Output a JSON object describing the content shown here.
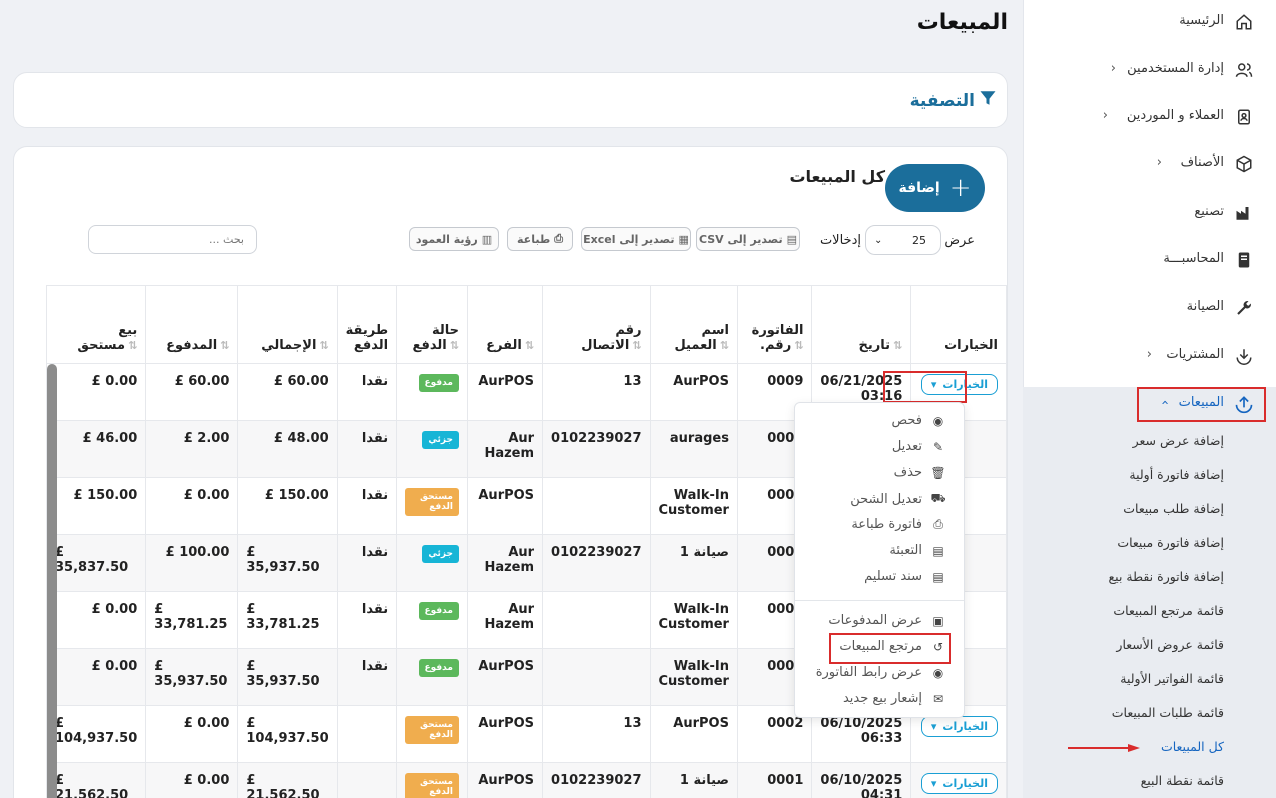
{
  "page": {
    "title": "المبيعات"
  },
  "sidebar": {
    "items": [
      {
        "label": "الرئيسية",
        "icon": "home-icon"
      },
      {
        "label": "إدارة المستخدمين",
        "icon": "users-icon"
      },
      {
        "label": "العملاء و الموردين",
        "icon": "contacts-icon"
      },
      {
        "label": "الأصناف",
        "icon": "box-icon"
      },
      {
        "label": "تصنيع",
        "icon": "factory-icon"
      },
      {
        "label": "المحاسبـــة",
        "icon": "book-icon"
      },
      {
        "label": "الصيانة",
        "icon": "wrench-icon"
      },
      {
        "label": "المشتريات",
        "icon": "download-icon"
      },
      {
        "label": "المبيعات",
        "icon": "upload-icon"
      }
    ],
    "sales_submenu": [
      "إضافة عرض سعر",
      "إضافة فاتورة أولية",
      "إضافة طلب مبيعات",
      "إضافة فاتورة مبيعات",
      "إضافة فاتورة نقطة بيع",
      "قائمة مرتجع المبيعات",
      "قائمة عروض الأسعار",
      "قائمة الفواتير الأولية",
      "قائمة طلبات المبيعات",
      "كل المبيعات",
      "قائمة نقطة البيع"
    ],
    "active_sub": "كل المبيعات"
  },
  "filter": {
    "title": "التصفية"
  },
  "list": {
    "title": "كل المبيعات",
    "add_label": "إضافة",
    "show_label": "عرض",
    "entries_value": "25",
    "entries_label": "إدخالات",
    "buttons": {
      "csv": "تصدير إلى CSV",
      "excel": "تصدير إلى Excel",
      "print": "طباعة",
      "columns": "رؤية العمود"
    },
    "search_placeholder": "بحث ..."
  },
  "table": {
    "headers": {
      "options": "الخيارات",
      "date": "تاريخ",
      "invoice_no_1": "رقم.",
      "invoice_no_2": "الفاتورة",
      "customer_1": "اسم",
      "customer_2": "العميل",
      "phone_1": "رقم",
      "phone_2": "الاتصال",
      "branch": "الفرع",
      "pay_status_1": "حالة",
      "pay_status_2": "الدفع",
      "pay_method_1": "طريقة",
      "pay_method_2": "الدفع",
      "total": "الإجمالي",
      "paid": "المدفوع",
      "due_1": "بيع",
      "due_2": "مستحق"
    },
    "options_label": "الخيارات",
    "rows": [
      {
        "date": "06/21/2025",
        "time": "03:16",
        "invoice": "0009",
        "customer": "AurPOS",
        "phone": "13",
        "branch": "AurPOS",
        "status": "مدفوع",
        "status_color": "#5cb85c",
        "method": "نقدا",
        "total": "£ 60.00",
        "paid": "£ 60.00",
        "due": "£ 0.00",
        "show_option": true
      },
      {
        "date": "",
        "time": "",
        "invoice": "0008",
        "customer": "aurages",
        "phone": "0102239027",
        "branch": "Aur Hazem",
        "status": "جزئي",
        "status_color": "#17b5d6",
        "method": "نقدا",
        "total": "£ 48.00",
        "paid": "£ 2.00",
        "due": "£ 46.00",
        "show_option": false
      },
      {
        "date": "",
        "time": "",
        "invoice": "0007",
        "customer": "Walk-In Customer",
        "phone": "",
        "branch": "AurPOS",
        "status": "مستحق الدفع",
        "status_color": "#f0ad4e",
        "method": "نقدا",
        "total": "£ 150.00",
        "paid": "£ 0.00",
        "due": "£ 150.00",
        "show_option": false
      },
      {
        "date": "",
        "time": "",
        "invoice": "0006",
        "customer": "صيانة 1",
        "phone": "0102239027",
        "branch": "Aur Hazem",
        "status": "جزئي",
        "status_color": "#17b5d6",
        "method": "نقدا",
        "total": "£ 35,937.50",
        "paid": "£ 100.00",
        "due": "£ 35,837.50",
        "show_option": false
      },
      {
        "date": "",
        "time": "",
        "invoice": "0005",
        "customer": "Walk-In Customer",
        "phone": "",
        "branch": "Aur Hazem",
        "status": "مدفوع",
        "status_color": "#5cb85c",
        "method": "نقدا",
        "total": "£ 33,781.25",
        "paid": "£ 33,781.25",
        "due": "£ 0.00",
        "show_option": false
      },
      {
        "date": "",
        "time": "",
        "invoice": "0003",
        "customer": "Walk-In Customer",
        "phone": "",
        "branch": "AurPOS",
        "status": "مدفوع",
        "status_color": "#5cb85c",
        "method": "نقدا",
        "total": "£ 35,937.50",
        "paid": "£ 35,937.50",
        "due": "£ 0.00",
        "show_option": false
      },
      {
        "date": "06/10/2025",
        "time": "06:33",
        "invoice": "0002",
        "customer": "AurPOS",
        "phone": "13",
        "branch": "AurPOS",
        "status": "مستحق الدفع",
        "status_color": "#f0ad4e",
        "method": "",
        "total": "£ 104,937.50",
        "paid": "£ 0.00",
        "due": "£ 104,937.50",
        "show_option": true
      },
      {
        "date": "06/10/2025",
        "time": "04:31",
        "invoice": "0001",
        "customer": "صيانة 1",
        "phone": "0102239027",
        "branch": "AurPOS",
        "status": "مستحق الدفع",
        "status_color": "#f0ad4e",
        "method": "",
        "total": "£ 21,562.50",
        "paid": "£ 0.00",
        "due": "£ 21,562.50",
        "show_option": true
      }
    ]
  },
  "dropdown": {
    "items": [
      {
        "label": "فحص",
        "icon": "eye-icon"
      },
      {
        "label": "تعديل",
        "icon": "edit-icon"
      },
      {
        "label": "حذف",
        "icon": "trash-icon"
      },
      {
        "label": "تعديل الشحن",
        "icon": "truck-icon"
      },
      {
        "label": "فاتورة طباعة",
        "icon": "printer-icon"
      },
      {
        "label": "التعبئة",
        "icon": "file-icon"
      },
      {
        "label": "سند تسليم",
        "icon": "file-icon"
      },
      {
        "label": "عرض المدفوعات",
        "icon": "money-icon"
      },
      {
        "label": "مرتجع المبيعات",
        "icon": "undo-icon"
      },
      {
        "label": "عرض رابط الفاتورة",
        "icon": "eye-icon"
      },
      {
        "label": "إشعار بيع جديد",
        "icon": "mail-icon"
      }
    ]
  },
  "colors": {
    "primary": "#1b6e9b",
    "accent": "#1a9fd4",
    "highlight": "#d92c2c"
  }
}
